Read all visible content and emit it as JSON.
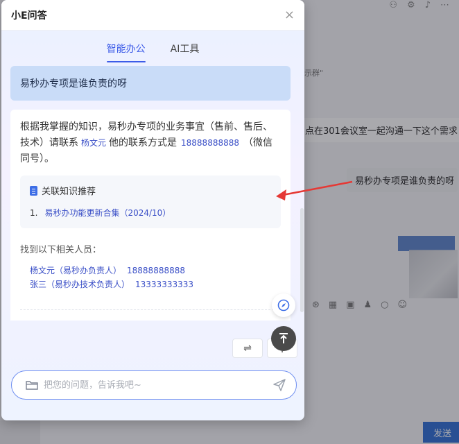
{
  "modal": {
    "title": "小E问答",
    "close": "×",
    "tabs": [
      {
        "label": "智能办公",
        "active": true
      },
      {
        "label": "AI工具",
        "active": false
      }
    ],
    "question": "易秒办专项是谁负责的呀",
    "answer": {
      "part1": "根据我掌握的知识，易秒办专项的业务事宜（售前、售后、技术）请联系",
      "contact_name": "杨文元",
      "part2": "他的联系方式是",
      "contact_phone": "18888888888",
      "part3": "（微信同号）。"
    },
    "knowledge": {
      "title": "关联知识推荐",
      "items": [
        {
          "index": "1.",
          "label": "易秒办功能更新合集（2024/10）"
        }
      ]
    },
    "people": {
      "heading": "找到以下相关人员：",
      "list": [
        {
          "name": "杨文元（易秒办负责人）",
          "phone": "18888888888"
        },
        {
          "name": "张三（易秒办技术负责人）",
          "phone": "13333333333"
        }
      ]
    },
    "input": {
      "placeholder": "把您的问题，告诉我吧~"
    },
    "buttons": {
      "switch": "⇌",
      "plus": "+"
    }
  },
  "background": {
    "snippet": "示群\"",
    "bubble1": "点在301会议室一起沟通一下这个需求",
    "bubble2": "易秒办专项是谁负责的呀",
    "send": "发送"
  },
  "colors": {
    "accent": "#3d5ce8",
    "link": "#3a4fc7",
    "annotation_arrow": "#e53935",
    "send_button": "#2f6fd6"
  }
}
